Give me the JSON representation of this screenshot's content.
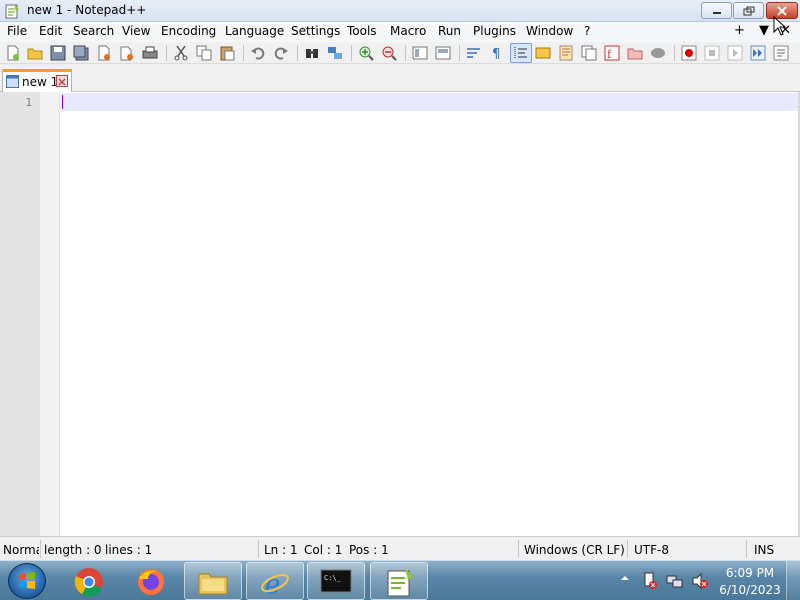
{
  "window": {
    "title": "new 1 - Notepad++",
    "app_icon": "notepadpp-icon",
    "buttons": [
      "minimize-icon",
      "maximize-icon",
      "close-icon"
    ]
  },
  "menu": {
    "items": [
      "File",
      "Edit",
      "Search",
      "View",
      "Encoding",
      "Language",
      "Settings",
      "Tools",
      "Macro",
      "Run",
      "Plugins",
      "Window",
      "?"
    ],
    "right": [
      "+",
      "▼",
      "✕"
    ]
  },
  "toolbar": {
    "icons": [
      "new-file-icon",
      "open-file-icon",
      "save-icon",
      "save-all-icon",
      "close-icon",
      "close-all-icon",
      "print-icon",
      "cut-icon",
      "copy-icon",
      "paste-icon",
      "undo-icon",
      "redo-icon",
      "find-icon",
      "replace-icon",
      "zoom-in-icon",
      "zoom-out-icon",
      "sync-vertical-icon",
      "sync-horizontal-icon",
      "word-wrap-icon",
      "show-all-chars-icon",
      "indent-guide-icon",
      "udl-icon",
      "doc-map-icon",
      "doc-list-icon",
      "function-list-icon",
      "folder-workspace-icon",
      "monitoring-icon",
      "record-macro-icon",
      "stop-macro-icon",
      "play-macro-icon",
      "run-macro-multiple-icon",
      "save-macro-icon"
    ]
  },
  "tabs": [
    {
      "label": "new 1",
      "active": true
    }
  ],
  "editor": {
    "line_numbers": [
      "1"
    ],
    "content": ""
  },
  "statusbar": {
    "mode": "Normal text file",
    "length": "length : 0",
    "lines": "lines : 1",
    "ln": "Ln : 1",
    "col": "Col : 1",
    "pos": "Pos : 1",
    "eol": "Windows (CR LF)",
    "encoding": "UTF-8",
    "insert_mode": "INS"
  },
  "taskbar": {
    "apps": [
      "chrome-icon",
      "firefox-icon",
      "file-explorer-icon",
      "internet-explorer-icon",
      "cmd-icon",
      "notepadpp-icon"
    ],
    "tray": [
      "show-hidden-icons-icon",
      "action-center-icon",
      "network-icon",
      "volume-icon"
    ],
    "clock_time": "6:09 PM",
    "clock_date": "6/10/2023"
  },
  "colors": {
    "tab_accent": "#f0a030",
    "current_line": "#e8e8ff",
    "caret": "#8000ff",
    "close_button": "#c8412b"
  }
}
